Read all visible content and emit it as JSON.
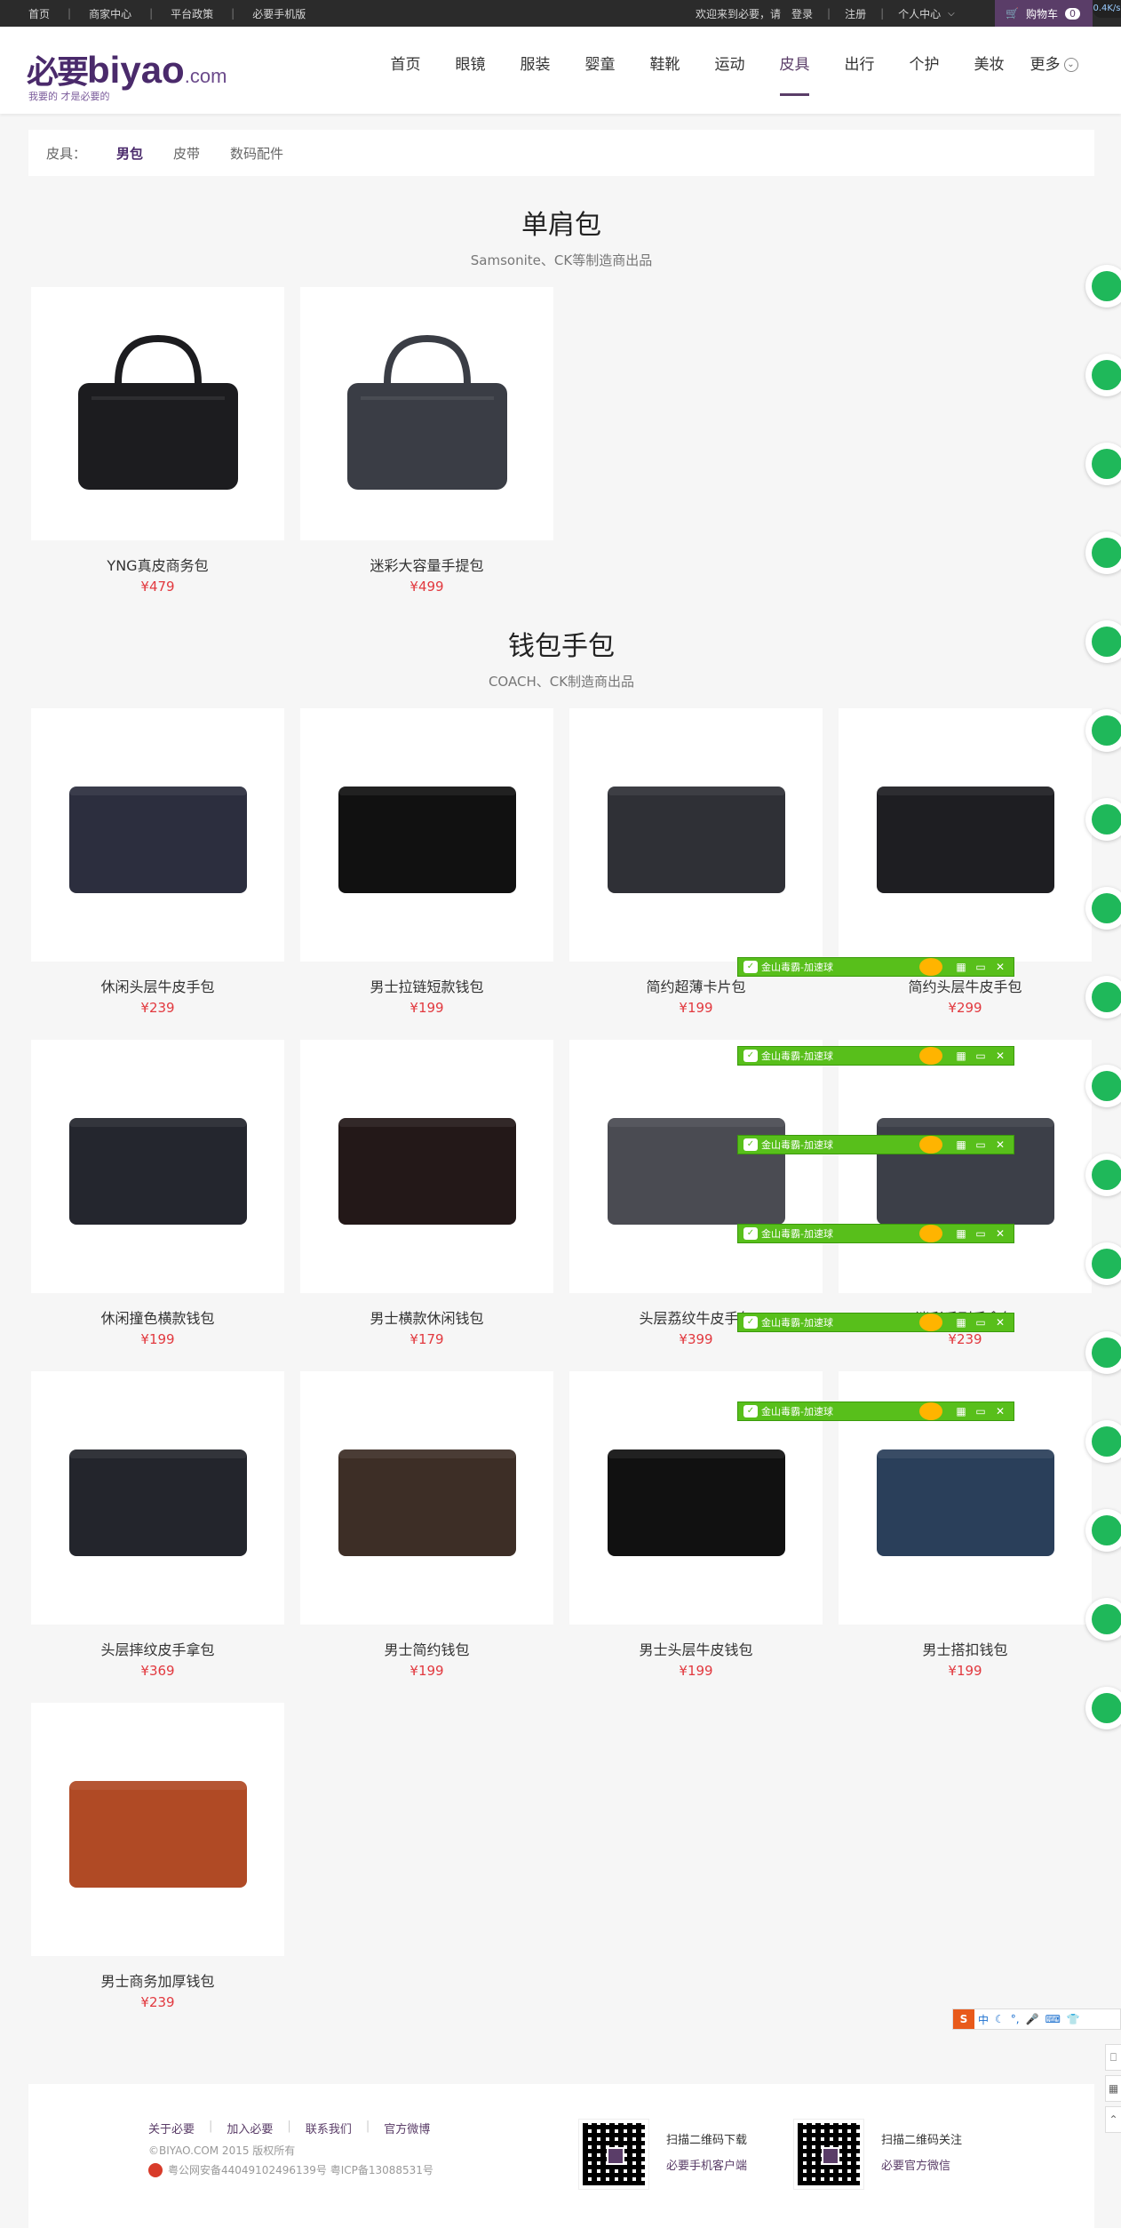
{
  "topbar": {
    "links": [
      "首页",
      "商家中心",
      "平台政策",
      "必要手机版"
    ],
    "welcome": "欢迎来到必要，请",
    "login": "登录",
    "register": "注册",
    "account": "个人中心",
    "cart_label": "购物车",
    "cart_count": "0",
    "speed": "0.4K/s"
  },
  "logo": {
    "cn": "必要",
    "en": "biyao",
    "com": ".com",
    "slogan": "我要的 才是必要的"
  },
  "nav": {
    "items": [
      "首页",
      "眼镜",
      "服装",
      "婴童",
      "鞋靴",
      "运动",
      "皮具",
      "出行",
      "个护",
      "美妆",
      "更多"
    ],
    "active": "皮具"
  },
  "filter": {
    "label": "皮具：",
    "items": [
      "男包",
      "皮带",
      "数码配件"
    ],
    "active": "男包"
  },
  "sections": [
    {
      "title": "单肩包",
      "subtitle": "Samsonite、CK等制造商出品",
      "products": [
        {
          "name": "YNG真皮商务包",
          "price": "¥479",
          "color": "#1c1c1f"
        },
        {
          "name": "迷彩大容量手提包",
          "price": "¥499",
          "color": "#3a3d45"
        }
      ]
    },
    {
      "title": "钱包手包",
      "subtitle": "COACH、CK制造商出品",
      "products": [
        {
          "name": "休闲头层牛皮手包",
          "price": "¥239",
          "color": "#2c2e3e"
        },
        {
          "name": "男士拉链短款钱包",
          "price": "¥199",
          "color": "#111"
        },
        {
          "name": "简约超薄卡片包",
          "price": "¥199",
          "color": "#2f3036"
        },
        {
          "name": "简约头层牛皮手包",
          "price": "¥299",
          "color": "#1e1e22"
        },
        {
          "name": "休闲撞色横款钱包",
          "price": "¥199",
          "color": "#24262e"
        },
        {
          "name": "男士横款休闲钱包",
          "price": "¥179",
          "color": "#231818"
        },
        {
          "name": "头层荔纹牛皮手包",
          "price": "¥399",
          "color": "#4a4b52"
        },
        {
          "name": "迷彩系列手拿包",
          "price": "¥239",
          "color": "#3c3f48"
        },
        {
          "name": "头层摔纹皮手拿包",
          "price": "¥369",
          "color": "#23252c"
        },
        {
          "name": "男士简约钱包",
          "price": "¥199",
          "color": "#3d2e26"
        },
        {
          "name": "男士头层牛皮钱包",
          "price": "¥199",
          "color": "#111"
        },
        {
          "name": "男士搭扣钱包",
          "price": "¥199",
          "color": "#2a3f5a"
        },
        {
          "name": "男士商务加厚钱包",
          "price": "¥239",
          "color": "#b04a25"
        }
      ]
    }
  ],
  "ad": {
    "text": "金山毒霸-加速球"
  },
  "ime": {
    "items": [
      "中",
      "·",
      "°",
      "5"
    ]
  },
  "footer": {
    "links": [
      "关于必要",
      "加入必要",
      "联系我们",
      "官方微博"
    ],
    "copyright": "©BIYAO.COM 2015 版权所有",
    "icp": "粤公网安备44049102496139号 粤ICP备13088531号",
    "qr1_title": "扫描二维码下载",
    "qr1_sub": "必要手机客户端",
    "qr2_title": "扫描二维码关注",
    "qr2_sub": "必要官方微信"
  }
}
